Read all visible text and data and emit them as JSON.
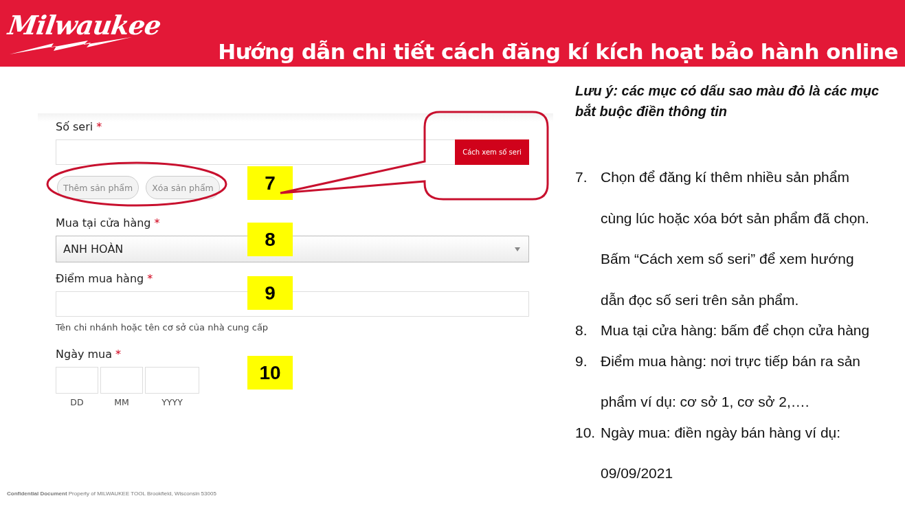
{
  "header": {
    "logo": "Milwaukee",
    "title": "Hướng dẫn chi tiết cách đăng kí kích hoạt bảo hành online"
  },
  "form": {
    "fields": [
      {
        "kind": "serial",
        "label": "Số seri",
        "mark": "*",
        "button": "Cách xem số seri",
        "actions": [
          "Thêm sản phẩm",
          "Xóa sản phẩm"
        ],
        "marker": "7"
      },
      {
        "kind": "select",
        "label": "Mua tại cửa hàng",
        "mark": "*",
        "value": "ANH HOÀN",
        "marker": "8"
      },
      {
        "kind": "text",
        "label": "Điểm mua hàng",
        "mark": "*",
        "help": "Tên chi nhánh hoặc tên cơ sở của nhà cung cấp",
        "marker": "9"
      },
      {
        "kind": "date",
        "label": "Ngày mua",
        "mark": "*",
        "parts": [
          "DD",
          "MM",
          "YYYY"
        ],
        "marker": "10"
      }
    ]
  },
  "note": "Lưu ý: các mục có dấu sao màu đỏ là các mục bắt buộc điền thông tin",
  "steps": [
    {
      "number": "7.",
      "text": "Chọn để đăng kí thêm nhiều sản phẩm cùng lúc hoặc xóa bớt sản phẩm đã chọn. Bấm “Cách xem số seri” để xem hướng dẫn đọc số seri trên sản phẩm."
    },
    {
      "number": "8.",
      "text": "Mua tại cửa hàng: bấm để chọn cửa hàng"
    },
    {
      "number": "9.",
      "text": "Điểm mua hàng: nơi trực tiếp bán ra sản phẩm ví dụ: cơ sở 1, cơ sở 2,…."
    },
    {
      "number": "10.",
      "text": "Ngày mua: điền ngày bán hàng ví dụ: 09/09/2021"
    }
  ],
  "footer": "**Confidential Document** Property of MILWAUKEE TOOL Brookfield, Wisconsin 53005"
}
